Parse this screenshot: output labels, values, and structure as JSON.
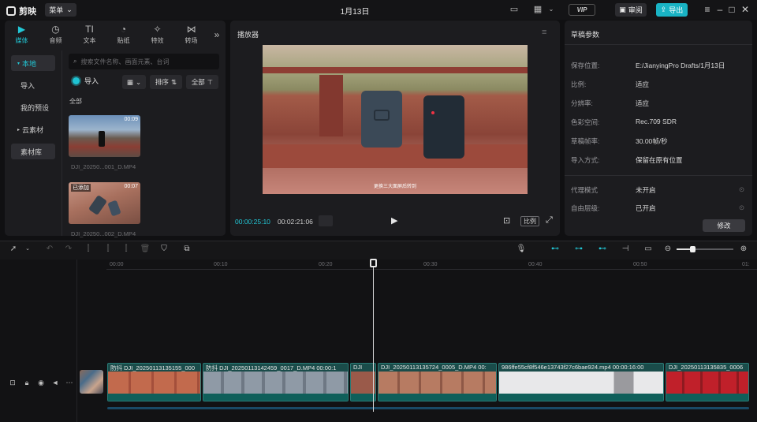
{
  "app": {
    "brand": "剪映",
    "menu_label": "菜单",
    "window_title": "1月13日"
  },
  "topbar": {
    "vip": "VIP",
    "review": "审阅",
    "export": "导出"
  },
  "media_tabs": [
    {
      "label": "媒体",
      "icon": "media-icon"
    },
    {
      "label": "音频",
      "icon": "audio-icon"
    },
    {
      "label": "文本",
      "icon": "text-icon"
    },
    {
      "label": "贴纸",
      "icon": "sticker-icon"
    },
    {
      "label": "特效",
      "icon": "effects-icon"
    },
    {
      "label": "转场",
      "icon": "transition-icon"
    }
  ],
  "sidenav": [
    {
      "label": "本地"
    },
    {
      "label": "导入"
    },
    {
      "label": "我的预设"
    },
    {
      "label": "云素材"
    },
    {
      "label": "素材库"
    }
  ],
  "library": {
    "search_placeholder": "搜索文件名称、画面元素、台词",
    "import_label": "导入",
    "sort_label": "排序",
    "filter_label": "全部",
    "section_label": "全部",
    "items": [
      {
        "name": "DJI_20250...001_D.MP4",
        "duration": "00:09",
        "added": ""
      },
      {
        "name": "DJI_20250...002_D.MP4",
        "duration": "00:07",
        "added": "已添加"
      }
    ]
  },
  "player": {
    "header": "播放器",
    "current_time": "00:00:25:10",
    "total_time": "00:02:21:06",
    "subtitle": "更换三大面屏后转到",
    "ratio_label": "比例"
  },
  "draft": {
    "header": "草稿参数",
    "rows": [
      {
        "label": "保存位置:",
        "value": "E:/JianyingPro Drafts/1月13日"
      },
      {
        "label": "比例:",
        "value": "适应"
      },
      {
        "label": "分辨率:",
        "value": "适应"
      },
      {
        "label": "色彩空间:",
        "value": "Rec.709 SDR"
      },
      {
        "label": "草稿帧率:",
        "value": "30.00帧/秒"
      },
      {
        "label": "导入方式:",
        "value": "保留在原有位置"
      },
      {
        "label": "代理模式",
        "value": "未开启"
      },
      {
        "label": "自由层级:",
        "value": "已开启"
      }
    ],
    "edit_label": "修改"
  },
  "ruler": [
    "00:00",
    "00:10",
    "00:20",
    "00:30",
    "00:40",
    "00:50",
    "01:"
  ],
  "clips": [
    {
      "label": "防抖  DJI_20250113135155_000",
      "color": "#c26a4d"
    },
    {
      "label": "防抖  DJI_20250113142459_0017_D.MP4  00:00:1",
      "color": "#8f9aa6"
    },
    {
      "label": "DJI",
      "color": "#9a5a4a"
    },
    {
      "label": "DJI_20250113135724_0005_D.MP4  00:",
      "color": "#b77b62"
    },
    {
      "label": "986ffe55cf8f546e13743f27c6bae924.mp4  00:00:16:00",
      "color": "#e8e8ea"
    },
    {
      "label": "DJI_20250113135835_0006",
      "color": "#c0202a"
    }
  ]
}
